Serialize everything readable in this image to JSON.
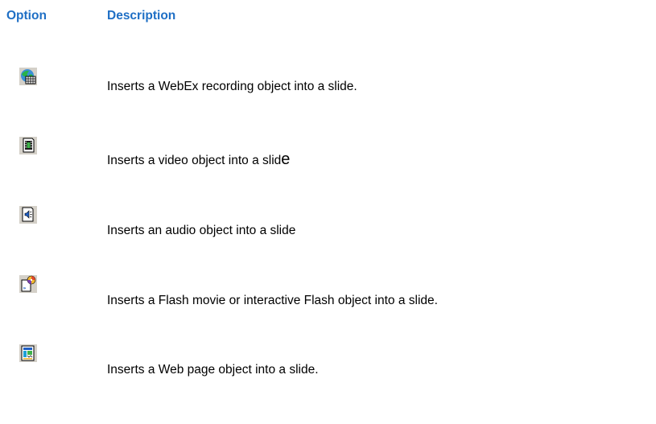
{
  "table": {
    "headers": {
      "option": "Option",
      "description": "Description"
    },
    "rows": [
      {
        "icon": "webex-recording-icon",
        "description": "Inserts a WebEx recording object into a slide."
      },
      {
        "icon": "video-object-icon",
        "description": "Inserts a video object into a slid",
        "description_tail": "e"
      },
      {
        "icon": "audio-object-icon",
        "description": "Inserts an audio object into a slide"
      },
      {
        "icon": "flash-object-icon",
        "description": "Inserts a Flash movie or interactive Flash object into a slide."
      },
      {
        "icon": "web-page-object-icon",
        "description": "Inserts a Web page object into a slide."
      }
    ]
  },
  "colors": {
    "header_text": "#1f6fc5",
    "body_text": "#000000",
    "icon_bg": "#d4d0c8"
  }
}
